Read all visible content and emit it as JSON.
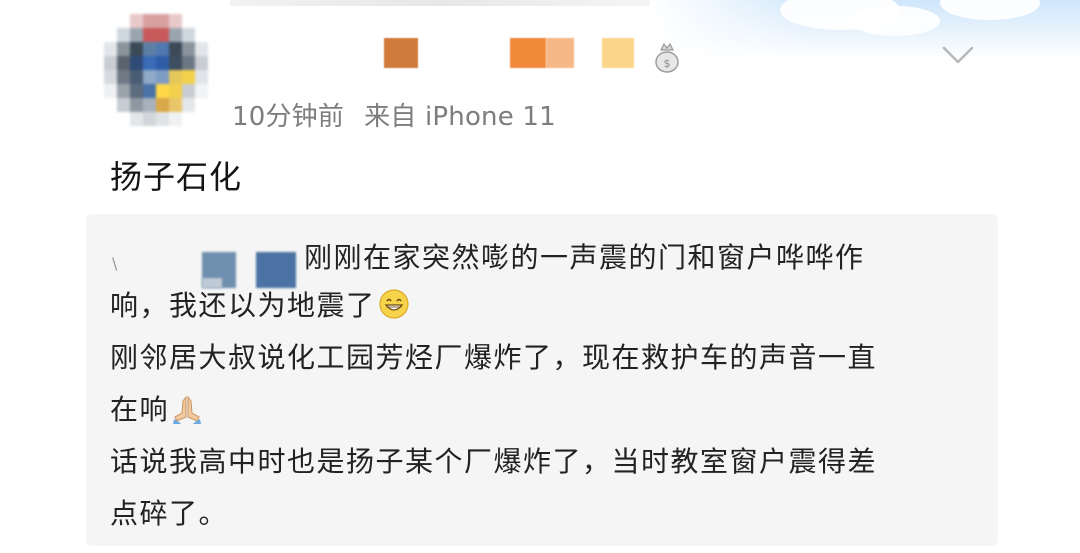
{
  "header": {
    "timestamp": "10分钟前",
    "source": "来自 iPhone 11",
    "badge_icon": "vip-bag-icon",
    "menu_icon": "chevron-down-icon"
  },
  "post": {
    "text": "扬子石化"
  },
  "repost": {
    "line1_rest": "刚刚在家突然嘭的一声震的门和窗户哗哗作",
    "line2": "响，我还以为地震了",
    "line3": "刚邻居大叔说化工园芳烃厂爆炸了，现在救护车的声音一直",
    "line4": "在响",
    "line5": "话说我高中时也是扬子某个厂爆炸了，当时教室窗户震得差",
    "line6": "点碎了。",
    "emoji_1": "grin-emoji-icon",
    "emoji_2": "pray-emoji-icon"
  },
  "colors": {
    "meta_gray": "#7d7d7d",
    "repost_bg": "#f5f5f5",
    "text": "#141414"
  }
}
